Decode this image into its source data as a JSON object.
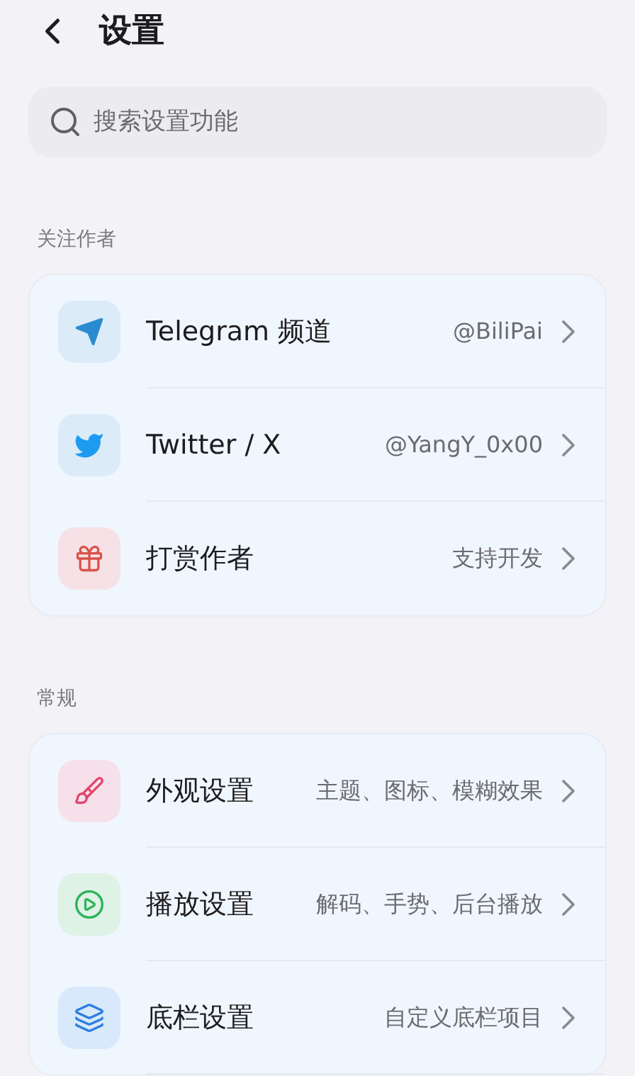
{
  "header": {
    "title": "设置"
  },
  "search": {
    "placeholder": "搜索设置功能"
  },
  "sections": [
    {
      "title": "关注作者",
      "items": [
        {
          "kind": "telegram",
          "label": "Telegram 频道",
          "value": "@BiliPai"
        },
        {
          "kind": "twitter",
          "label": "Twitter / X",
          "value": "@YangY_0x00"
        },
        {
          "kind": "gift",
          "label": "打赏作者",
          "value": "支持开发"
        }
      ]
    },
    {
      "title": "常规",
      "items": [
        {
          "kind": "brush",
          "label": "外观设置",
          "value": "主题、图标、模糊效果"
        },
        {
          "kind": "play",
          "label": "播放设置",
          "value": "解码、手势、后台播放"
        },
        {
          "kind": "layers",
          "label": "底栏设置",
          "value": "自定义底栏项目"
        }
      ]
    }
  ]
}
